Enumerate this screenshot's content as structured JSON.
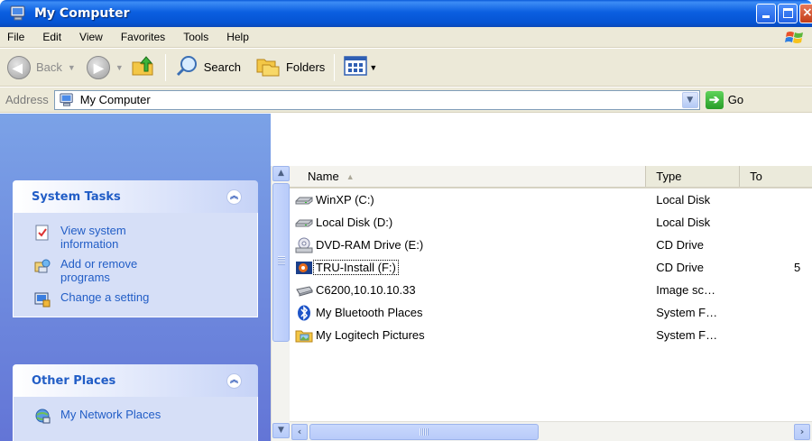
{
  "window": {
    "title": "My Computer"
  },
  "menu": [
    "File",
    "Edit",
    "View",
    "Favorites",
    "Tools",
    "Help"
  ],
  "toolbar": {
    "back_label": "Back",
    "search_label": "Search",
    "folders_label": "Folders"
  },
  "address": {
    "label": "Address",
    "value": "My Computer",
    "go_label": "Go"
  },
  "tasks_pane": {
    "system_tasks": {
      "title": "System Tasks",
      "items": [
        {
          "label": "View system information",
          "icon": "system-info-icon"
        },
        {
          "label": "Add or remove programs",
          "icon": "add-remove-programs-icon"
        },
        {
          "label": "Change a setting",
          "icon": "control-panel-icon"
        }
      ]
    },
    "other_places": {
      "title": "Other Places",
      "items": [
        {
          "label": "My Network Places",
          "icon": "network-places-icon"
        }
      ]
    }
  },
  "list": {
    "columns": {
      "name": "Name",
      "type": "Type",
      "total": "To"
    },
    "items": [
      {
        "name": "WinXP (C:)",
        "type": "Local Disk",
        "total": "",
        "icon": "hard-disk-icon"
      },
      {
        "name": "Local Disk (D:)",
        "type": "Local Disk",
        "total": "",
        "icon": "hard-disk-icon"
      },
      {
        "name": "DVD-RAM Drive (E:)",
        "type": "CD Drive",
        "total": "",
        "icon": "dvd-drive-icon"
      },
      {
        "name": "TRU-Install (F:)",
        "type": "CD Drive",
        "total": "5",
        "icon": "cd-drive-icon"
      },
      {
        "name": "C6200,10.10.10.33",
        "type": "Image sc…",
        "total": "",
        "icon": "scanner-icon"
      },
      {
        "name": "My Bluetooth Places",
        "type": "System F…",
        "total": "",
        "icon": "bluetooth-icon"
      },
      {
        "name": "My Logitech Pictures",
        "type": "System F…",
        "total": "",
        "icon": "pictures-folder-icon"
      }
    ]
  },
  "colors": {
    "title_bar": "#0553d3",
    "task_pane": "#6375d6",
    "task_link": "#215dc6",
    "chrome": "#ece9d8"
  }
}
